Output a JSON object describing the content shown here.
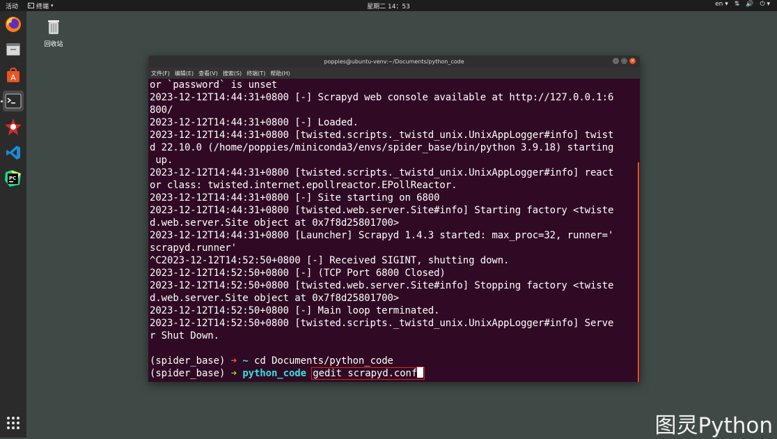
{
  "topbar": {
    "activities": "活动",
    "app_menu": "终端",
    "clock": "星期二 14：53",
    "language": "en",
    "indicators": [
      "network-icon",
      "volume-icon",
      "power-icon"
    ]
  },
  "dock": {
    "items": [
      "firefox-icon",
      "files-icon",
      "software-center-icon",
      "terminal-icon",
      "app-icon",
      "vscode-icon",
      "pycharm-icon"
    ],
    "show_apps_icon": "grid-icon"
  },
  "desktop": {
    "trash_label": "回收站"
  },
  "window": {
    "title": "poppies@ubuntu-venv:~/Documents/python_code",
    "menu": [
      "文件(F)",
      "编辑(E)",
      "查看(V)",
      "搜索(S)",
      "终端(T)",
      "帮助(H)"
    ]
  },
  "terminal": {
    "lines": [
      "or `password` is unset",
      "2023-12-12T14:44:31+0800 [-] Scrapyd web console available at http://127.0.0.1:6",
      "800/",
      "2023-12-12T14:44:31+0800 [-] Loaded.",
      "2023-12-12T14:44:31+0800 [twisted.scripts._twistd_unix.UnixAppLogger#info] twist",
      "d 22.10.0 (/home/poppies/miniconda3/envs/spider_base/bin/python 3.9.18) starting",
      " up.",
      "2023-12-12T14:44:31+0800 [twisted.scripts._twistd_unix.UnixAppLogger#info] react",
      "or class: twisted.internet.epollreactor.EPollReactor.",
      "2023-12-12T14:44:31+0800 [-] Site starting on 6800",
      "2023-12-12T14:44:31+0800 [twisted.web.server.Site#info] Starting factory <twiste",
      "d.web.server.Site object at 0x7f8d25801700>",
      "2023-12-12T14:44:31+0800 [Launcher] Scrapyd 1.4.3 started: max_proc=32, runner='",
      "scrapyd.runner'",
      "^C2023-12-12T14:52:50+0800 [-] Received SIGINT, shutting down.",
      "2023-12-12T14:52:50+0800 [-] (TCP Port 6800 Closed)",
      "2023-12-12T14:52:50+0800 [twisted.web.server.Site#info] Stopping factory <twiste",
      "d.web.server.Site object at 0x7f8d25801700>",
      "2023-12-12T14:52:50+0800 [-] Main loop terminated.",
      "2023-12-12T14:52:50+0800 [twisted.scripts._twistd_unix.UnixAppLogger#info] Serve",
      "r Shut Down.",
      ""
    ],
    "prompt1": {
      "env": "(spider_base)",
      "arrow": "➜",
      "dir": "~",
      "command": "cd Documents/python_code"
    },
    "prompt2": {
      "env": "(spider_base)",
      "arrow": "➜",
      "dir": "python_code",
      "command": "gedit scrapyd.conf"
    }
  },
  "watermark": "图灵Python",
  "colors": {
    "terminal_bg": "#300a24",
    "accent": "#e95420",
    "highlight_box": "#e02020"
  }
}
